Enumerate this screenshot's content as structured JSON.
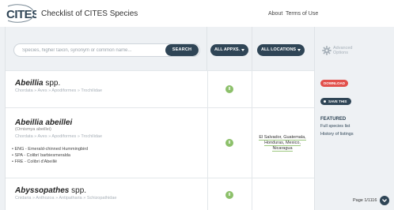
{
  "header": {
    "logo_text": "CITES",
    "title": "Checklist of CITES Species",
    "nav": [
      "About",
      "Terms of Use"
    ]
  },
  "search": {
    "placeholder": "Species, higher taxon, synonym or common name...",
    "button_label": "SEARCH"
  },
  "filters": {
    "appendices_label": "ALL APPXS.",
    "locations_label": "ALL LOCATIONS",
    "advanced_label": "Advanced Options"
  },
  "results": [
    {
      "name": "Abeillia",
      "suffix": "spp.",
      "lineage": [
        "Chordata",
        "Aves",
        "Apodiformes",
        "Trochilidae"
      ],
      "appendix": "II",
      "locations": ""
    },
    {
      "name": "Abeillia abeillei",
      "suffix": "",
      "synonym": "(Ornismya abeillei)",
      "lineage": [
        "Chordata",
        "Aves",
        "Apodiformes",
        "Trochilidae"
      ],
      "common_names": [
        "ENG - Emerald-chinned Hummingbird",
        "SPA - Colibrí barbiesmeralda",
        "FRE - Colibri d'Abeillé"
      ],
      "appendix": "II",
      "locations": "El Salvador, Guatemala, Honduras, Mexico, Nicaragua"
    },
    {
      "name": "Abyssopathes",
      "suffix": "spp.",
      "lineage": [
        "Cnidaria",
        "Anthozoa",
        "Antipatharia",
        "Schizopathidae"
      ],
      "appendix": "II",
      "locations": ""
    }
  ],
  "sidebar": {
    "download_label": "DOWNLOAD",
    "save_label": "SAVE THIS",
    "featured_title": "FEATURED",
    "featured_links": [
      "Full species list",
      "History of listings"
    ]
  },
  "pagination": {
    "text": "Page 1/1116"
  },
  "colors": {
    "brand_dark": "#2f4556",
    "appendix_ii": "#8cc06a",
    "download": "#e2504c"
  }
}
